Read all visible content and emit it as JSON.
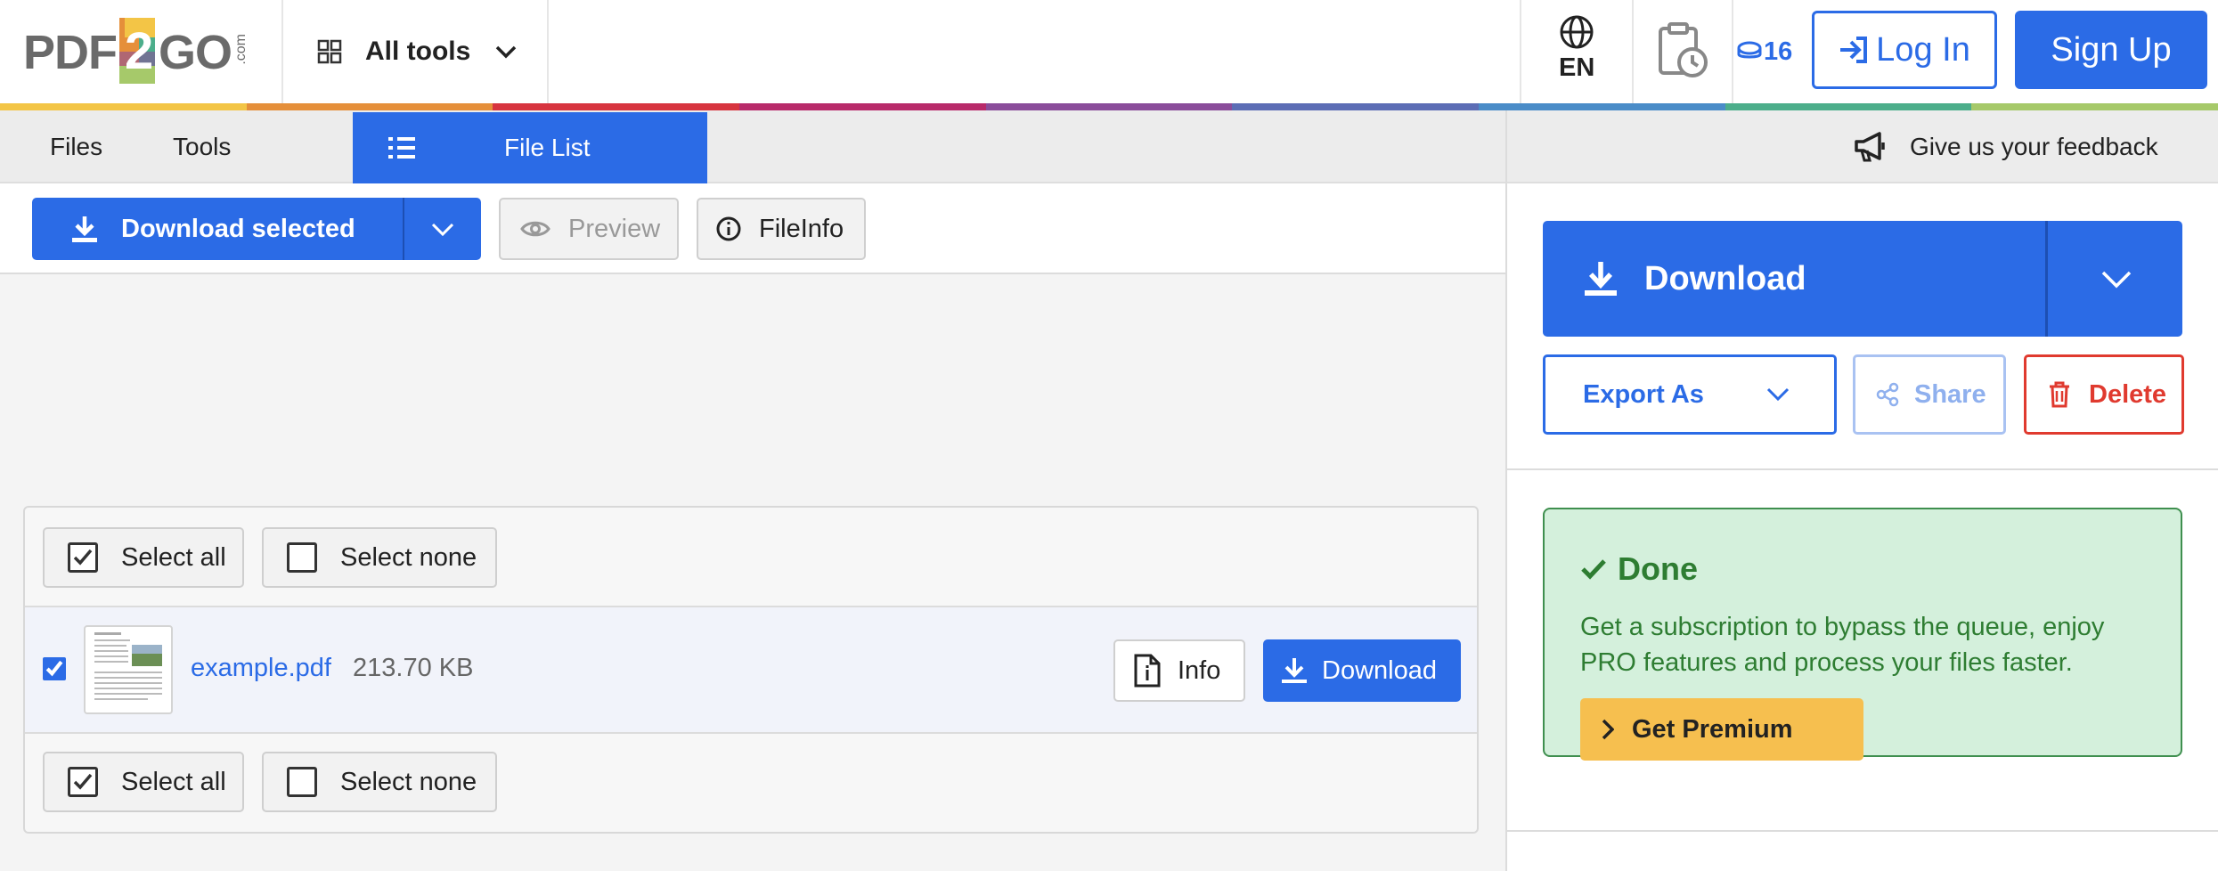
{
  "header": {
    "logo": "PDF2GO",
    "logo_suffix": ".com",
    "all_tools": "All tools",
    "language": "EN",
    "credits": "16",
    "login": "Log In",
    "signup": "Sign Up"
  },
  "subnav": {
    "files": "Files",
    "tools": "Tools",
    "file_list": "File List",
    "feedback": "Give us your feedback"
  },
  "toolbar": {
    "download_selected": "Download selected",
    "preview": "Preview",
    "fileinfo": "FileInfo"
  },
  "filelist": {
    "select_all": "Select all",
    "select_none": "Select none",
    "file": {
      "name": "example.pdf",
      "size": "213.70 KB",
      "checked": true,
      "info": "Info",
      "download": "Download"
    }
  },
  "panel": {
    "download": "Download",
    "export_as": "Export As",
    "share": "Share",
    "delete": "Delete",
    "done_title": "Done",
    "done_text": "Get a subscription to bypass the queue, enjoy PRO features and process your files faster.",
    "get_premium": "Get Premium"
  },
  "colors": {
    "primary": "#2b6be6",
    "danger": "#e03a2f",
    "success_bg": "#d4f0dc",
    "success_text": "#2e7d32",
    "premium": "#f6bf4f",
    "rainbow": [
      "#f3c546",
      "#e58f3a",
      "#d7343f",
      "#b82a6a",
      "#8a4c9a",
      "#5c6db5",
      "#4a8cc8",
      "#4cae8b",
      "#a6c96a"
    ]
  }
}
